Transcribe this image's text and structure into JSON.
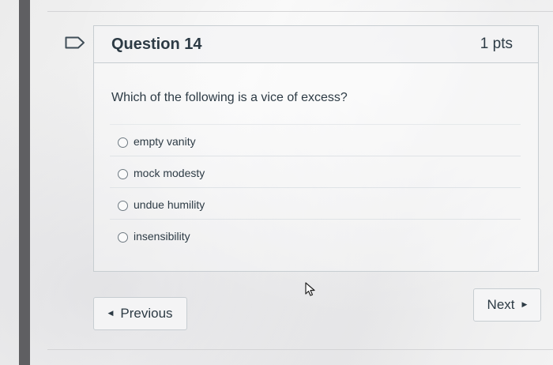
{
  "question": {
    "title": "Question 14",
    "points": "1 pts",
    "text": "Which of the following is a vice of excess?",
    "answers": [
      {
        "label": "empty vanity"
      },
      {
        "label": "mock modesty"
      },
      {
        "label": "undue humility"
      },
      {
        "label": "insensibility"
      }
    ]
  },
  "nav": {
    "previous_label": "Previous",
    "next_label": "Next",
    "previous_icon": "caret-left-icon",
    "next_icon": "caret-right-icon"
  },
  "icons": {
    "flag": "flag-icon",
    "cursor": "pointer-cursor-icon"
  },
  "colors": {
    "text": "#2d3b45",
    "border": "#c7cdd1",
    "left_bar": "#5f5f62"
  }
}
